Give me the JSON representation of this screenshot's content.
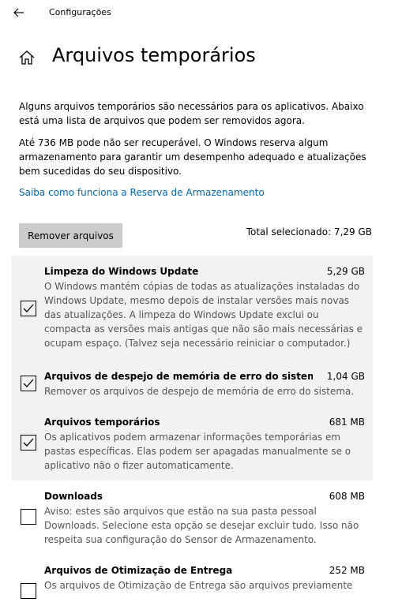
{
  "window": {
    "title": "Configurações"
  },
  "header": {
    "title": "Arquivos temporários"
  },
  "intro": {
    "paragraph_1": "Alguns arquivos temporários são necessários para os aplicativos. Abaixo está uma lista de arquivos que podem ser removidos agora.",
    "paragraph_2": "Até 736 MB pode não ser recuperável. O Windows reserva algum armazenamento para garantir um desempenho adequado e atualizações bem sucedidas do seu dispositivo.",
    "link_label": "Saiba como funciona a Reserva de Armazenamento"
  },
  "actions": {
    "remove_label": "Remover arquivos",
    "total_selected": "Total selecionado: 7,29 GB"
  },
  "items": [
    {
      "name": "Limpeza do Windows Update",
      "size": "5,29 GB",
      "checked": true,
      "description": "O Windows mantém cópias de todas as atualizações instaladas do Windows Update, mesmo depois de instalar versões mais novas das atualizações. A limpeza do Windows Update exclui ou compacta as versões mais antigas que não são mais necessárias e ocupam espaço. (Talvez seja necessário reiniciar o computador.)"
    },
    {
      "name": "Arquivos de despejo de memória de erro do sistema",
      "size": "1,04 GB",
      "checked": true,
      "description": "Remover os arquivos de despejo de memória de erro do sistema."
    },
    {
      "name": "Arquivos temporários",
      "size": "681 MB",
      "checked": true,
      "description": "Os aplicativos podem armazenar informações temporárias em pastas específicas. Elas podem ser apagadas manualmente se o aplicativo não o fizer automaticamente."
    },
    {
      "name": "Downloads",
      "size": "608 MB",
      "checked": false,
      "description": "Aviso: estes são arquivos que estão na sua pasta pessoal Downloads. Selecione esta opção se desejar excluir tudo. Isso não respeita sua configuração do Sensor de Armazenamento."
    },
    {
      "name": "Arquivos de Otimização de Entrega",
      "size": "252 MB",
      "checked": false,
      "description": "Os arquivos de Otimização de Entrega são arquivos previamente"
    }
  ],
  "colors": {
    "accent_link": "#0067b8",
    "selected_row_bg": "#f2f2f2",
    "button_bg": "#cccccc",
    "secondary_text": "#555555"
  },
  "icons": {
    "back": "back-arrow-icon",
    "home": "home-icon",
    "checkbox": "checkmark-icon"
  }
}
